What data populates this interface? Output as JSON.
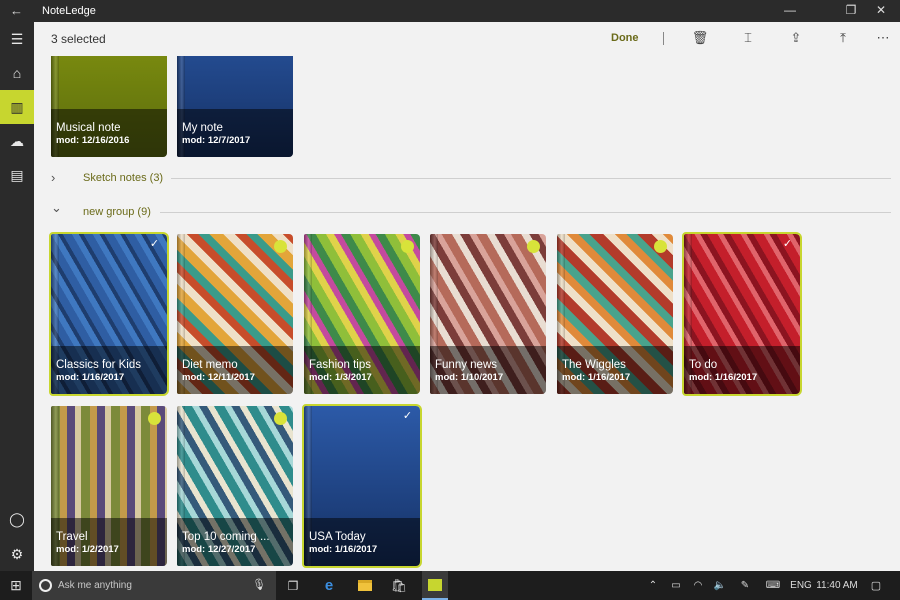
{
  "window": {
    "title": "NoteLedge",
    "back_glyph": "←",
    "min_glyph": "—",
    "restore_glyph": "❐",
    "close_glyph": "✕"
  },
  "sidebar": {
    "items": [
      {
        "icon": "hamburger-icon",
        "glyph": "☰"
      },
      {
        "icon": "home-icon",
        "glyph": "⌂"
      },
      {
        "icon": "library-icon",
        "glyph": "▥",
        "active": true
      },
      {
        "icon": "cloud-icon",
        "glyph": "☁"
      },
      {
        "icon": "clipboard-icon",
        "glyph": "▤"
      }
    ],
    "bottom": [
      {
        "icon": "account-icon",
        "glyph": "◯"
      },
      {
        "icon": "settings-icon",
        "glyph": "⚙"
      }
    ]
  },
  "command_bar": {
    "selected_count": "3 selected",
    "done_label": "Done",
    "icons": [
      {
        "name": "delete-icon",
        "glyph": "🗑"
      },
      {
        "name": "rename-icon",
        "glyph": "⌶"
      },
      {
        "name": "share-icon",
        "glyph": "⇪"
      },
      {
        "name": "move-up-icon",
        "glyph": "⤒"
      },
      {
        "name": "more-icon",
        "glyph": "⋯"
      }
    ]
  },
  "top_notebooks": [
    {
      "name": "Musical note",
      "mod": "mod: 12/16/2016",
      "cover": "olive"
    },
    {
      "name": "My note",
      "mod": "mod: 12/7/2017",
      "cover": "blue"
    }
  ],
  "groups": [
    {
      "label": "Sketch notes (3)",
      "expanded": false,
      "chevron": "›"
    },
    {
      "label": "new group (9)",
      "expanded": true,
      "chevron": "⌄"
    }
  ],
  "notebooks": [
    {
      "name": "Classics for Kids",
      "mod": "mod: 1/16/2017",
      "cover": "blue-diamond",
      "state": "selected"
    },
    {
      "name": "Diet memo",
      "mod": "mod: 12/11/2017",
      "cover": "harlequin-warm",
      "state": "unselected"
    },
    {
      "name": "Fashion tips",
      "mod": "mod: 1/3/2017",
      "cover": "triangles-bright",
      "state": "unselected"
    },
    {
      "name": "Funny news",
      "mod": "mod: 1/10/2017",
      "cover": "triangles-muted",
      "state": "unselected"
    },
    {
      "name": "The Wiggles",
      "mod": "mod: 1/16/2017",
      "cover": "harlequin-red",
      "state": "unselected"
    },
    {
      "name": "To do",
      "mod": "mod: 1/16/2017",
      "cover": "red-diamond",
      "state": "selected"
    },
    {
      "name": "Travel",
      "mod": "mod: 1/2/2017",
      "cover": "harlequin-earth",
      "state": "unselected"
    },
    {
      "name": "Top 10 coming ...",
      "mod": "mod: 12/27/2017",
      "cover": "triangles-teal",
      "state": "unselected"
    },
    {
      "name": "USA Today",
      "mod": "mod: 1/16/2017",
      "cover": "blue",
      "state": "selected"
    }
  ],
  "colors": {
    "accent": "#c7d62f",
    "sidebar_bg": "#2b2b2b",
    "group_text": "#6b6b1a",
    "page_bg": "#f2f2f2"
  },
  "taskbar": {
    "start_icon": "windows-start-icon",
    "search_placeholder": "Ask me anything",
    "apps": [
      "task-view-icon",
      "edge-icon",
      "file-explorer-icon",
      "store-icon",
      "noteledge-app-icon"
    ],
    "tray": {
      "language": "ENG",
      "time": "11:40 AM"
    }
  }
}
